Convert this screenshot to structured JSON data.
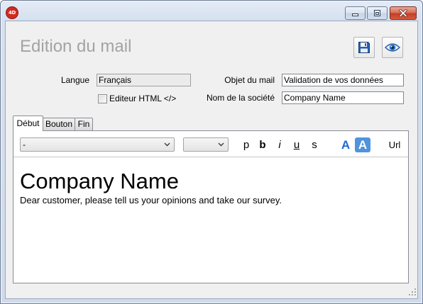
{
  "window": {
    "logo_text": "4D",
    "controls": {
      "minimize": {
        "icon": "minimize-icon"
      },
      "maximize": {
        "icon": "maximize-icon"
      },
      "close": {
        "icon": "close-icon"
      }
    }
  },
  "header": {
    "title": "Edition du mail",
    "save_button": {
      "icon": "floppy-disk-icon"
    },
    "preview_button": {
      "icon": "eye-icon"
    }
  },
  "form": {
    "language": {
      "label": "Langue",
      "value": "Français"
    },
    "subject": {
      "label": "Objet du mail",
      "value": "Validation de vos données"
    },
    "html_editor": {
      "label": "Editeur HTML </>",
      "checked": false
    },
    "company": {
      "label": "Nom de la société",
      "value": "Company Name"
    }
  },
  "tabs": [
    {
      "label": "Début",
      "selected": true
    },
    {
      "label": "Bouton",
      "selected": false
    },
    {
      "label": "Fin",
      "selected": false
    }
  ],
  "editor_toolbar": {
    "paragraph_style": {
      "value": "-",
      "icon": "chevron-down-icon"
    },
    "font_size": {
      "value": "",
      "icon": "chevron-down-icon"
    },
    "format_buttons": [
      {
        "label": "p"
      },
      {
        "label": "b"
      },
      {
        "label": "i"
      },
      {
        "label": "u"
      },
      {
        "label": "s"
      }
    ],
    "font_size_buttons": [
      {
        "label": "A",
        "active": false
      },
      {
        "label": "A",
        "active": true
      }
    ],
    "link_button": {
      "label": "Url"
    }
  },
  "editor_content": {
    "heading": "Company Name",
    "body": "Dear customer, please tell us your opinions and take our survey."
  },
  "colors": {
    "accent": "#1d6ad6",
    "accent_bg": "#4f94dc",
    "title_text": "#a3a3a3",
    "logo": "#d42a1e",
    "client_bg": "#f0f0f0"
  }
}
